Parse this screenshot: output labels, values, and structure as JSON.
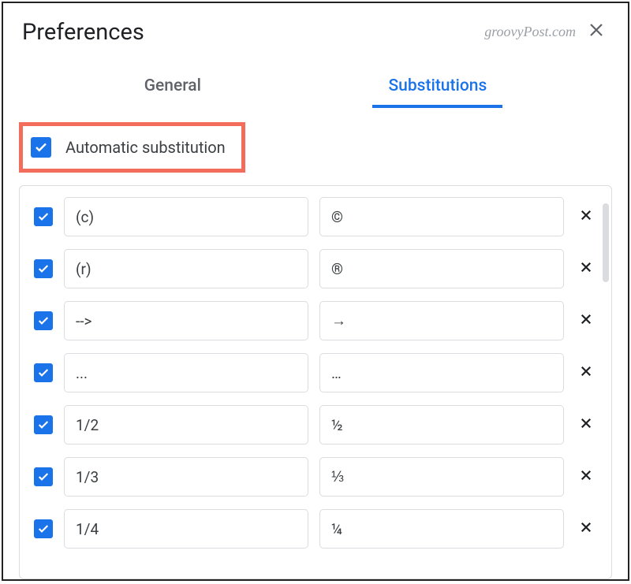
{
  "header": {
    "title": "Preferences",
    "watermark": "groovyPost.com"
  },
  "tabs": {
    "general": "General",
    "substitutions": "Substitutions"
  },
  "autoSubstitution": {
    "label": "Automatic substitution",
    "checked": true
  },
  "rows": [
    {
      "checked": true,
      "replace": "(c)",
      "with": "©"
    },
    {
      "checked": true,
      "replace": "(r)",
      "with": "®"
    },
    {
      "checked": true,
      "replace": "-->",
      "with": "→"
    },
    {
      "checked": true,
      "replace": "...",
      "with": "…"
    },
    {
      "checked": true,
      "replace": "1/2",
      "with": "½"
    },
    {
      "checked": true,
      "replace": "1/3",
      "with": "⅓"
    },
    {
      "checked": true,
      "replace": "1/4",
      "with": "¼"
    }
  ]
}
